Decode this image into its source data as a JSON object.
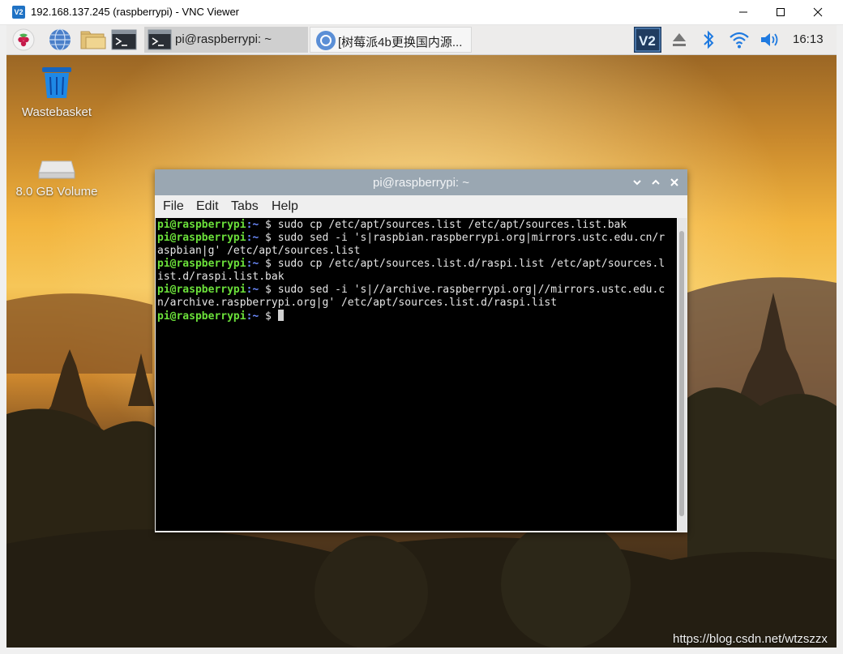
{
  "window": {
    "logo": "V2",
    "title": "192.168.137.245 (raspberrypi) - VNC Viewer"
  },
  "taskbar": {
    "tasks": [
      {
        "label": "pi@raspberrypi: ~",
        "icon": "terminal-icon"
      },
      {
        "label": "[树莓派4b更换国内源...",
        "icon": "chromium-icon"
      }
    ],
    "tray_icons": [
      "vnc-icon",
      "eject-icon",
      "bluetooth-icon",
      "wifi-icon",
      "volume-icon"
    ],
    "clock": "16:13"
  },
  "desktop": {
    "icons": [
      {
        "label": "Wastebasket",
        "icon": "wastebasket-icon"
      },
      {
        "label": "8.0 GB Volume",
        "icon": "drive-icon"
      }
    ]
  },
  "terminal": {
    "title": "pi@raspberrypi: ~",
    "menu": [
      "File",
      "Edit",
      "Tabs",
      "Help"
    ],
    "lines": [
      {
        "prompt": "pi@raspberrypi",
        "path": ":~",
        "cmd": " $ sudo cp /etc/apt/sources.list /etc/apt/sources.list.bak"
      },
      {
        "prompt": "pi@raspberrypi",
        "path": ":~",
        "cmd": " $ sudo sed -i 's|raspbian.raspberrypi.org|mirrors.ustc.edu.cn/r"
      },
      {
        "prompt": "",
        "path": "",
        "cmd": "aspbian|g' /etc/apt/sources.list"
      },
      {
        "prompt": "pi@raspberrypi",
        "path": ":~",
        "cmd": " $ sudo cp /etc/apt/sources.list.d/raspi.list /etc/apt/sources.l"
      },
      {
        "prompt": "",
        "path": "",
        "cmd": "ist.d/raspi.list.bak"
      },
      {
        "prompt": "pi@raspberrypi",
        "path": ":~",
        "cmd": " $ sudo sed -i 's|//archive.raspberrypi.org|//mirrors.ustc.edu.c"
      },
      {
        "prompt": "",
        "path": "",
        "cmd": "n/archive.raspberrypi.org|g' /etc/apt/sources.list.d/raspi.list"
      },
      {
        "prompt": "pi@raspberrypi",
        "path": ":~",
        "cmd": " $ "
      }
    ]
  },
  "watermark": "https://blog.csdn.net/wtzszzx",
  "colors": {
    "prompt": "#6be03a",
    "path": "#6d8cff",
    "terminal_bg": "#000000",
    "titlebar": "#9aa7b2"
  }
}
